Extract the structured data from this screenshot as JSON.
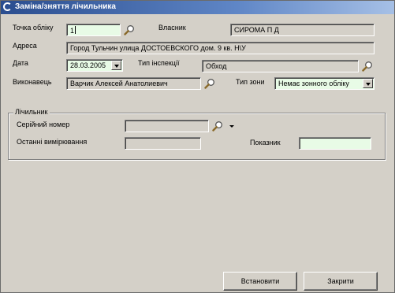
{
  "window": {
    "title": "Заміна/зняття лічильника"
  },
  "form": {
    "point_label": "Точка обліку",
    "point_value": "1",
    "owner_label": "Власник",
    "owner_value": "СИРОМА П Д",
    "address_label": "Адреса",
    "address_value": "Город Тульчин улица ДОСТОЕВСКОГО дом. 9 кв. Н\\У",
    "date_label": "Дата",
    "date_value": "28.03.2005",
    "inspection_type_label": "Тип інспекції",
    "inspection_type_value": "Обход",
    "executor_label": "Виконавець",
    "executor_value": "Варчик Алексей Анатолиевич",
    "zone_type_label": "Тип зони",
    "zone_type_value": "Немає зонного обліку"
  },
  "meter_group": {
    "legend": "Лічильник",
    "serial_label": "Серійний номер",
    "serial_value": "",
    "last_measure_label": "Останні вимірювання",
    "last_measure_value": "",
    "reading_label": "Показник",
    "reading_value": ""
  },
  "buttons": {
    "apply": "Встановити",
    "close": "Закрити"
  },
  "icons": {
    "search": "magnifier-icon",
    "window": "app-icon",
    "dropdown": "chevron-down-icon"
  },
  "colors": {
    "title_bar": "#2a4d8f",
    "window_bg": "#d4d0c8",
    "input_highlight": "#e8fbe6"
  }
}
